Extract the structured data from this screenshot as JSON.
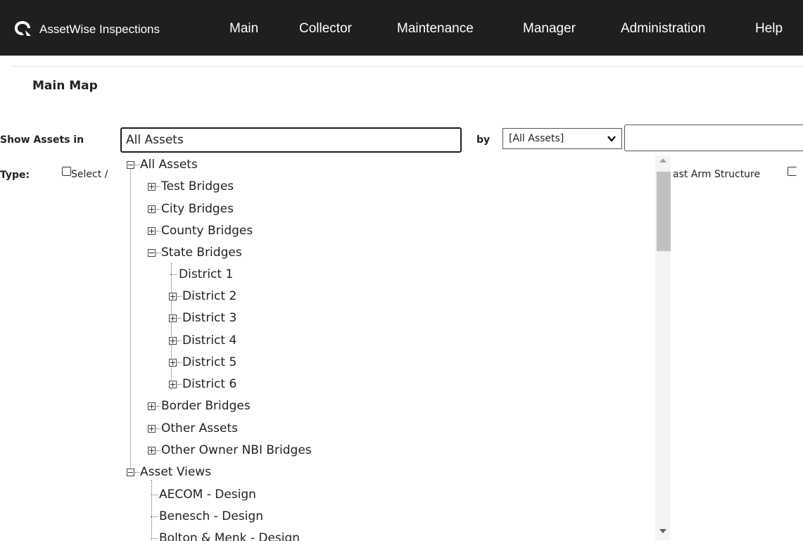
{
  "nav": {
    "brand": "AssetWise Inspections",
    "items": [
      "Main",
      "Collector",
      "Maintenance",
      "Manager",
      "Administration",
      "Help"
    ]
  },
  "page": {
    "title": "Main Map"
  },
  "filters": {
    "show_label": "Show Assets in",
    "show_value": "All Assets",
    "by_label": "by",
    "by_selected": "[All Assets]",
    "by_text_value": "",
    "type_label": "Type:",
    "select_all_text": "Select /",
    "right_type_text": "ast Arm Structure"
  },
  "tree": {
    "root": "All Assets",
    "groups": [
      "Test Bridges",
      "City Bridges",
      "County Bridges",
      "State Bridges"
    ],
    "districts": [
      "District 1",
      "District 2",
      "District 3",
      "District 4",
      "District 5",
      "District 6"
    ],
    "groups_after": [
      "Border Bridges",
      "Other Assets",
      "Other Owner NBI Bridges"
    ],
    "views_root": "Asset Views",
    "views": [
      "AECOM - Design",
      "Benesch - Design",
      "Bolton & Menk - Design"
    ]
  },
  "colors": {
    "nav_bg": "#1f1f1f",
    "nav_text": "#ffffff"
  }
}
